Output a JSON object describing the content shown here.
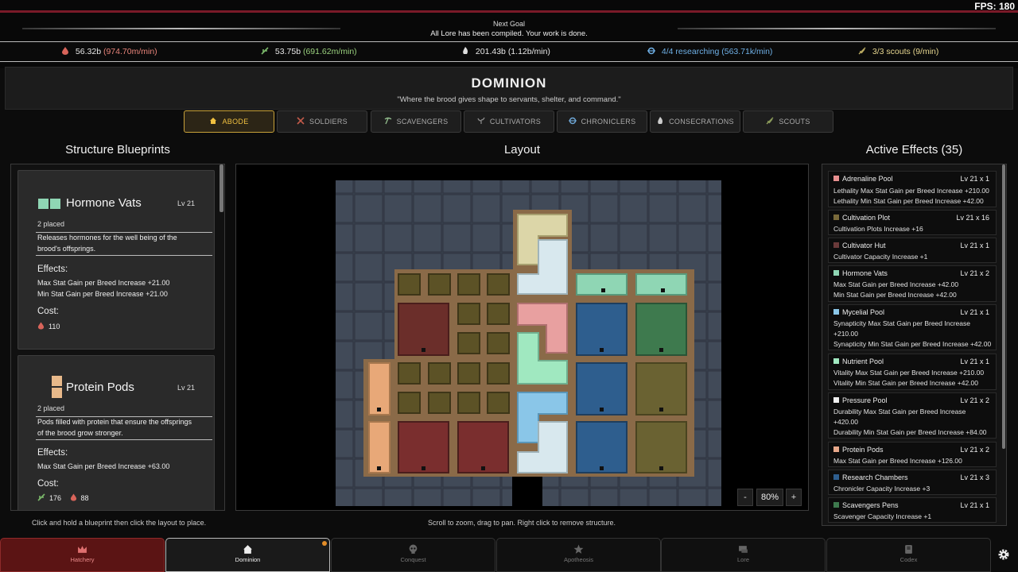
{
  "fps": "FPS: 180",
  "goal": {
    "title": "Next Goal",
    "text": "All Lore has been compiled. Your work is done."
  },
  "resources": [
    {
      "icon": "blood-drop-icon",
      "amount": "56.32b",
      "rate": "(974.70m/min)",
      "color": "#e8847a"
    },
    {
      "icon": "herb-icon",
      "amount": "53.75b",
      "rate": "(691.62m/min)",
      "color": "#9ad07e"
    },
    {
      "icon": "flame-icon",
      "amount": "201.43b",
      "rate": "(1.12b/min)",
      "color": "#e8e8e8"
    },
    {
      "icon": "research-icon",
      "amount": "4/4 researching",
      "rate": "(563.71k/min)",
      "color": "#6fb0e6"
    },
    {
      "icon": "scout-icon",
      "amount": "3/3 scouts",
      "rate": "(9/min)",
      "color": "#d6c68a"
    }
  ],
  "page": {
    "title": "DOMINION",
    "subtitle": "\"Where the brood gives shape to servants, shelter, and command.\""
  },
  "tabs": [
    {
      "label": "ABODE",
      "icon": "house-icon",
      "active": true
    },
    {
      "label": "SOLDIERS",
      "icon": "swords-icon"
    },
    {
      "label": "SCAVENGERS",
      "icon": "pickaxe-icon"
    },
    {
      "label": "CULTIVATORS",
      "icon": "sprout-icon"
    },
    {
      "label": "CHRONICLERS",
      "icon": "book-icon"
    },
    {
      "label": "CONSECRATIONS",
      "icon": "hand-icon"
    },
    {
      "label": "SCOUTS",
      "icon": "scout-icon"
    }
  ],
  "sections": {
    "blueprints": "Structure Blueprints",
    "layout": "Layout",
    "effects": "Active Effects (35)"
  },
  "blueprints": [
    {
      "name": "Hormone Vats",
      "level": "Lv 21",
      "placed": "2 placed",
      "desc": "Releases hormones for the well being of the brood's offsprings.",
      "effects_label": "Effects:",
      "effects": [
        "Max Stat Gain per Breed Increase +21.00",
        "Min Stat Gain per Breed Increase +21.00"
      ],
      "cost_label": "Cost:",
      "costs": [
        "110"
      ],
      "color": "#8fd6b4"
    },
    {
      "name": "Protein Pods",
      "level": "Lv 21",
      "placed": "2 placed",
      "desc": "Pods filled with protein that ensure the offsprings of the brood grow stronger.",
      "effects_label": "Effects:",
      "effects": [
        "Max Stat Gain per Breed Increase +63.00"
      ],
      "cost_label": "Cost:",
      "costs": [
        "176",
        "88"
      ],
      "color": "#e8b98a"
    }
  ],
  "hints": {
    "blueprints": "Click and hold a blueprint then click the layout to place.",
    "layout": "Scroll to zoom, drag to pan. Right click to remove structure."
  },
  "zoom": {
    "minus": "-",
    "value": "80%",
    "plus": "+"
  },
  "effects": [
    {
      "name": "Adrenaline Pool",
      "level": "Lv 21 x 1",
      "lines": [
        "Lethality Max Stat Gain per Breed Increase +210.00",
        "Lethality Min Stat Gain per Breed Increase +42.00"
      ],
      "color": "#e89090"
    },
    {
      "name": "Cultivation Plot",
      "level": "Lv 21 x 16",
      "lines": [
        "Cultivation Plots Increase +16"
      ],
      "color": "#7a6a3a"
    },
    {
      "name": "Cultivator Hut",
      "level": "Lv 21 x 1",
      "lines": [
        "Cultivator Capacity Increase +1"
      ],
      "color": "#6a3a3a"
    },
    {
      "name": "Hormone Vats",
      "level": "Lv 21 x 2",
      "lines": [
        "Max Stat Gain per Breed Increase +42.00",
        "Min Stat Gain per Breed Increase +42.00"
      ],
      "color": "#8fd6b4"
    },
    {
      "name": "Mycelial Pool",
      "level": "Lv 21 x 1",
      "lines": [
        "Synapticity Max Stat Gain per Breed Increase",
        "+210.00",
        "Synapticity Min Stat Gain per Breed Increase +42.00"
      ],
      "color": "#8ac6e8"
    },
    {
      "name": "Nutrient Pool",
      "level": "Lv 21 x 1",
      "lines": [
        "Vitality Max Stat Gain per Breed Increase +210.00",
        "Vitality Min Stat Gain per Breed Increase +42.00"
      ],
      "color": "#a0e8c0"
    },
    {
      "name": "Pressure Pool",
      "level": "Lv 21 x 2",
      "lines": [
        "Durability Max Stat Gain per Breed Increase",
        "+420.00",
        "Durability Min Stat Gain per Breed Increase +84.00"
      ],
      "color": "#f0f0f0"
    },
    {
      "name": "Protein Pods",
      "level": "Lv 21 x 2",
      "lines": [
        "Max Stat Gain per Breed Increase +126.00"
      ],
      "color": "#e8a88a"
    },
    {
      "name": "Research Chambers",
      "level": "Lv 21 x 3",
      "lines": [
        "Chronicler Capacity Increase +3"
      ],
      "color": "#2e5e8e"
    },
    {
      "name": "Scavengers Pens",
      "level": "Lv 21 x 1",
      "lines": [
        "Scavenger Capacity Increase +1"
      ],
      "color": "#3e7a4e"
    }
  ],
  "nav": [
    {
      "label": "Hatchery",
      "icon": "crown-icon",
      "state": "red"
    },
    {
      "label": "Dominion",
      "icon": "house-icon",
      "state": "active"
    },
    {
      "label": "Conquest",
      "icon": "skull-icon"
    },
    {
      "label": "Apotheosis",
      "icon": "star-icon"
    },
    {
      "label": "Lore",
      "icon": "scroll-icon"
    },
    {
      "label": "Codex",
      "icon": "codex-icon"
    }
  ]
}
